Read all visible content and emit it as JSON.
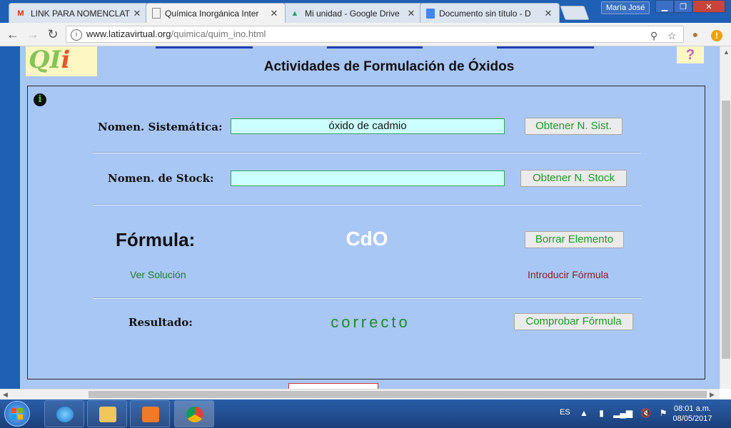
{
  "browser": {
    "tabs": [
      {
        "title": "LINK PARA NOMENCLAT",
        "icon": "gmail-icon",
        "active": false
      },
      {
        "title": "Química Inorgánica Inter",
        "icon": "page-icon",
        "active": true
      },
      {
        "title": "Mi unidad - Google Drive",
        "icon": "drive-icon",
        "active": false
      },
      {
        "title": "Documento sin título - D",
        "icon": "docs-icon",
        "active": false
      }
    ],
    "user": "María José",
    "url_host": "www.latizavirtual.org",
    "url_path": "/quimica/quim_ino.html"
  },
  "page": {
    "title": "Actividades de Formulación de Óxidos",
    "logo": "QI",
    "logo_i": "i",
    "help": "?",
    "systematic_label": "Nomen. Sistemática:",
    "systematic_value": "óxido de cadmio",
    "systematic_button": "Obtener N. Sist.",
    "stock_label": "Nomen. de Stock:",
    "stock_value": "",
    "stock_button": "Obtener N. Stock",
    "formula_label": "Fórmula:",
    "formula_value": "CdO",
    "delete_button": "Borrar Elemento",
    "solution_link": "Ver Solución",
    "enter_link": "Introducir Fórmula",
    "result_label": "Resultado:",
    "result_value": "correcto",
    "check_button": "Comprobar Fórmula"
  },
  "colors": {
    "page_bg": "#a9c7f5",
    "field_bg": "#ccffff",
    "button_text": "#1e9a2a",
    "solution_link": "#1e7a3a",
    "enter_link": "#8a1e2a"
  },
  "taskbar": {
    "lang": "ES",
    "time": "08:01 a.m.",
    "date": "08/05/2017"
  }
}
